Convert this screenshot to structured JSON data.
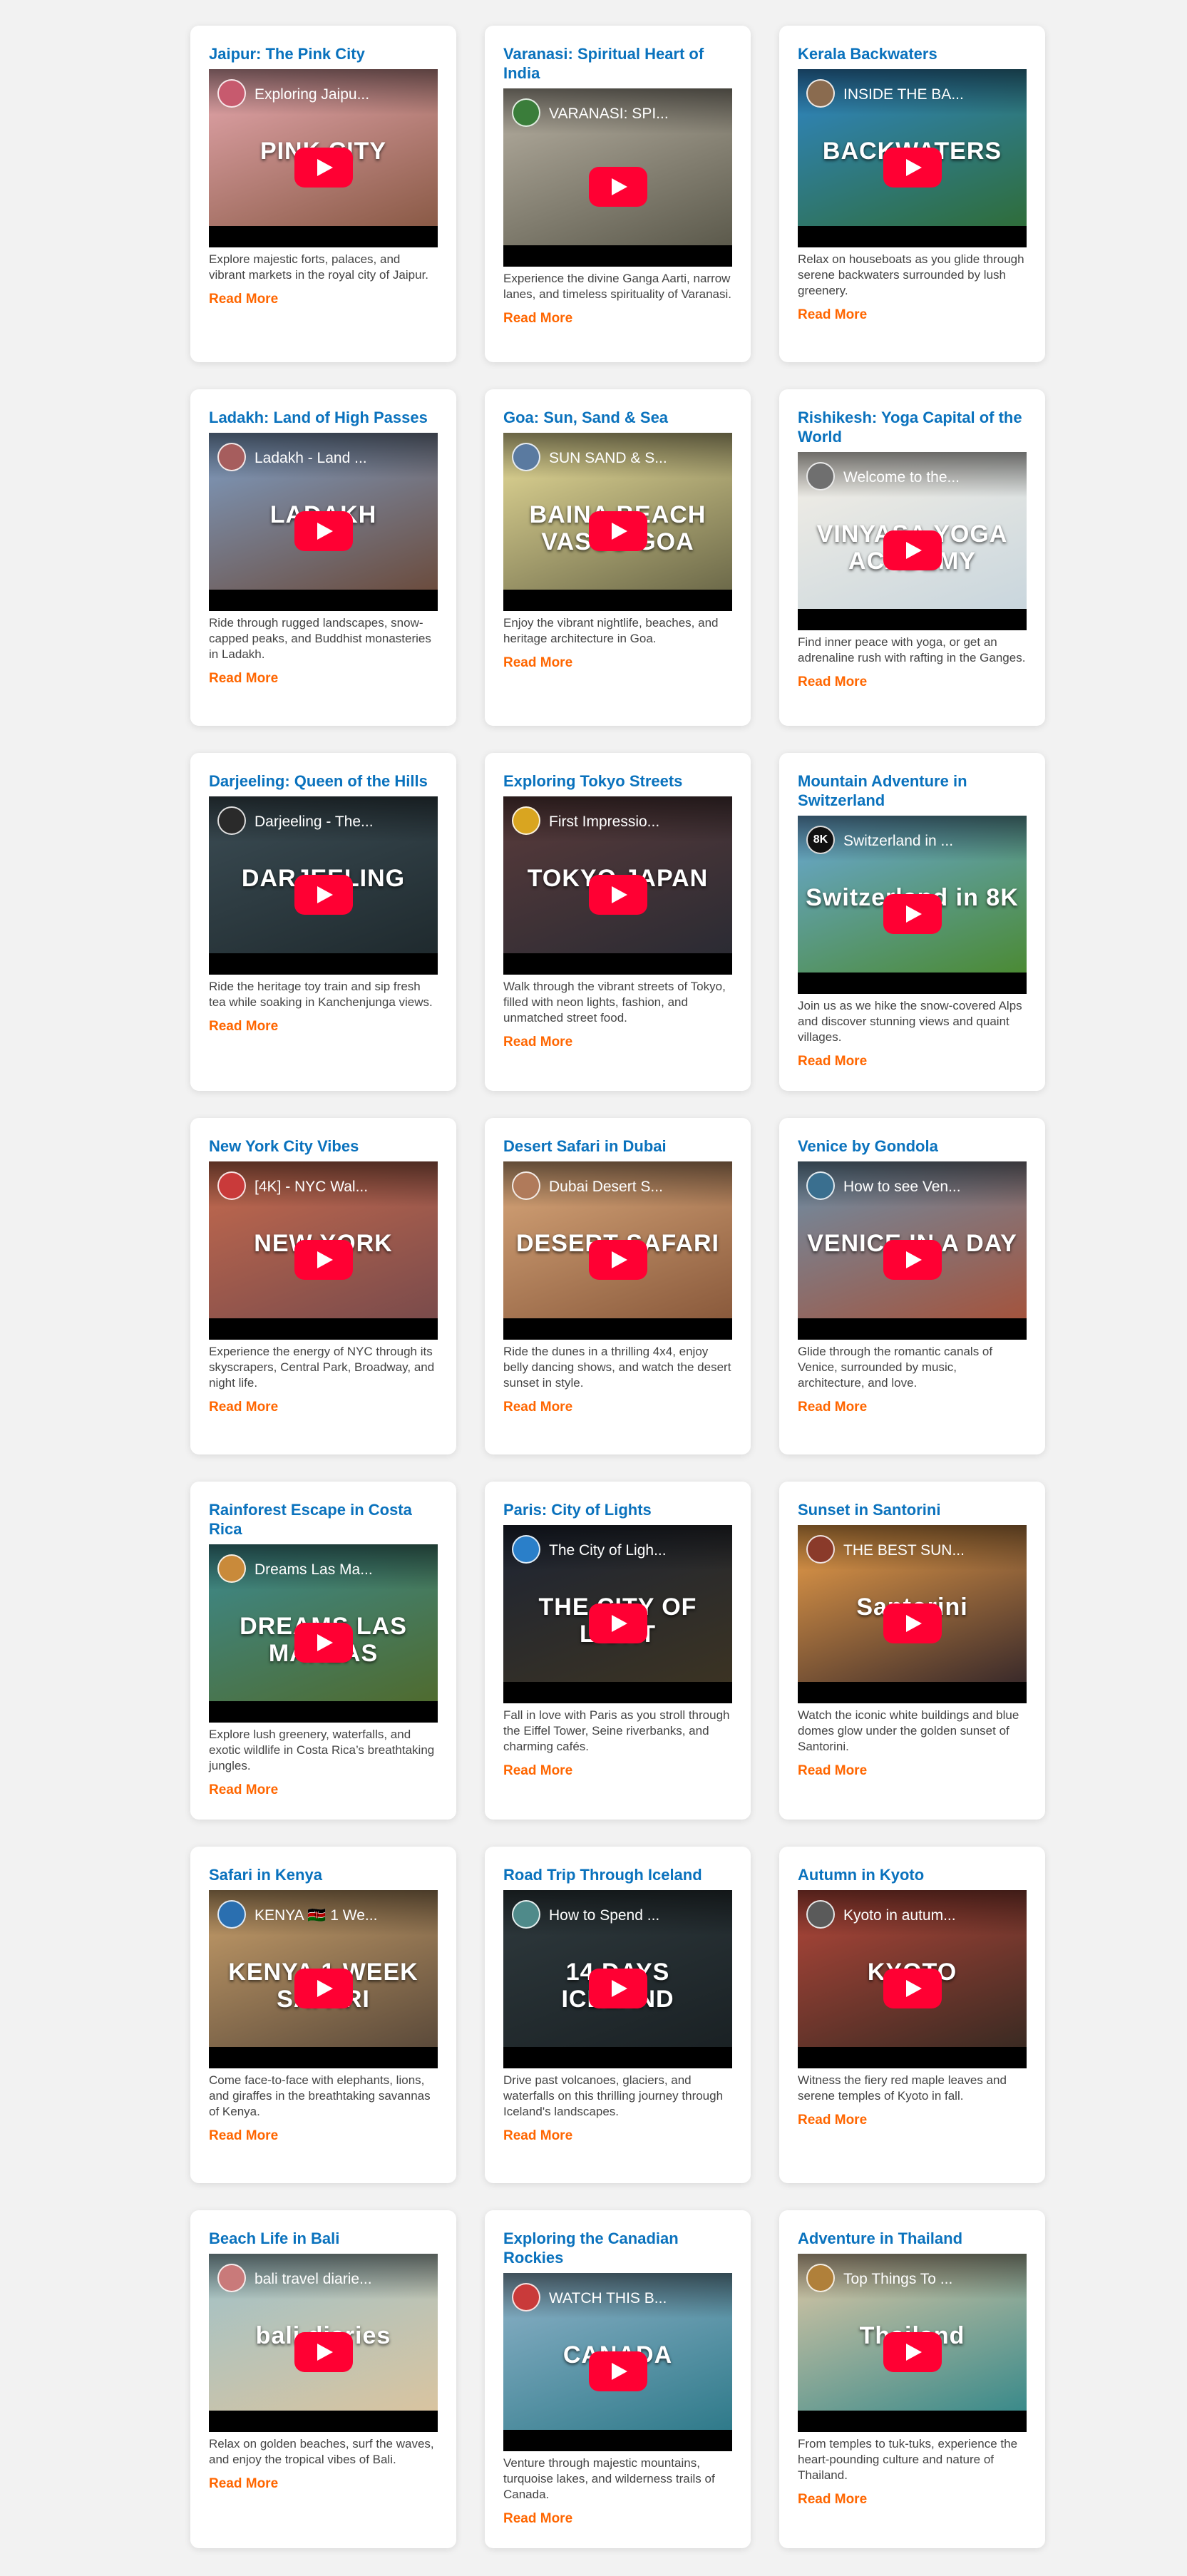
{
  "cards": [
    {
      "title": "Jaipur: The Pink City",
      "video_title": "Exploring Jaipu...",
      "overlay": "PINK CITY",
      "description": "Explore majestic forts, palaces, and vibrant markets in the royal city of Jaipur.",
      "read_more": "Read More",
      "colors": [
        "#e7a9b0",
        "#8a5a46"
      ],
      "avatar_color": "#c75a6e"
    },
    {
      "title": "Varanasi: Spiritual Heart of India",
      "video_title": "VARANASI: SPI...",
      "overlay": "",
      "description": "Experience the divine Ganga Aarti, narrow lanes, and timeless spirituality of Varanasi.",
      "read_more": "Read More",
      "colors": [
        "#b9b2a4",
        "#5c5a4c"
      ],
      "avatar_color": "#3a7d3a"
    },
    {
      "title": "Kerala Backwaters",
      "video_title": "INSIDE THE BA...",
      "overlay": "BACKWATERS",
      "description": "Relax on houseboats as you glide through serene backwaters surrounded by lush greenery.",
      "read_more": "Read More",
      "colors": [
        "#2f86c9",
        "#2f6d3a"
      ],
      "avatar_color": "#8a6b4f"
    },
    {
      "title": "Ladakh: Land of High Passes",
      "video_title": "Ladakh - Land ...",
      "overlay": "LADAKH",
      "description": "Ride through rugged landscapes, snow-capped peaks, and Buddhist monasteries in Ladakh.",
      "read_more": "Read More",
      "colors": [
        "#7f9fc6",
        "#6b4c3e"
      ],
      "avatar_color": "#a65d5d"
    },
    {
      "title": "Goa: Sun, Sand & Sea",
      "video_title": "SUN SAND & S...",
      "overlay": "BAINA BEACH VASCO GOA",
      "description": "Enjoy the vibrant nightlife, beaches, and heritage architecture in Goa.",
      "read_more": "Read More",
      "colors": [
        "#eadf9a",
        "#6d6a4a"
      ],
      "avatar_color": "#5a7aa0"
    },
    {
      "title": "Rishikesh: Yoga Capital of the World",
      "video_title": "Welcome to the...",
      "overlay": "VINYASA YOGA ACADEMY",
      "description": "Find inner peace with yoga, or get an adrenaline rush with rafting in the Ganges.",
      "read_more": "Read More",
      "colors": [
        "#f4efe6",
        "#c9d6dd"
      ],
      "avatar_color": "#6f6f6f"
    },
    {
      "title": "Darjeeling: Queen of the Hills",
      "video_title": "Darjeeling - The...",
      "overlay": "DARJEELING",
      "description": "Ride the heritage toy train and sip fresh tea while soaking in Kanchenjunga views.",
      "read_more": "Read More",
      "colors": [
        "#3c4d55",
        "#1f2a2e"
      ],
      "avatar_color": "#2a2a2a"
    },
    {
      "title": "Exploring Tokyo Streets",
      "video_title": "First Impressio...",
      "overlay": "TOKYO JAPAN",
      "description": "Walk through the vibrant streets of Tokyo, filled with neon lights, fashion, and unmatched street food.",
      "read_more": "Read More",
      "colors": [
        "#5a3b3b",
        "#2b2b33"
      ],
      "avatar_color": "#d9a520"
    },
    {
      "title": "Mountain Adventure in Switzerland",
      "video_title": "Switzerland in ...",
      "overlay": "Switzerland in 8K",
      "description": "Join us as we hike the snow-covered Alps and discover stunning views and quaint villages.",
      "read_more": "Read More",
      "colors": [
        "#6aa9d8",
        "#4b8a34"
      ],
      "avatar_color": "#111111",
      "avatar_text": "8K"
    },
    {
      "title": "New York City Vibes",
      "video_title": "[4K] - NYC Wal...",
      "overlay": "NEW YORK",
      "description": "Experience the energy of NYC through its skyscrapers, Central Park, Broadway, and night life.",
      "read_more": "Read More",
      "colors": [
        "#c56a4e",
        "#7a4b4b"
      ],
      "avatar_color": "#c93a3a"
    },
    {
      "title": "Desert Safari in Dubai",
      "video_title": "Dubai Desert S...",
      "overlay": "DESERT SAFARI",
      "description": "Ride the dunes in a thrilling 4x4, enjoy belly dancing shows, and watch the desert sunset in style.",
      "read_more": "Read More",
      "colors": [
        "#d9a87b",
        "#8a5a3c"
      ],
      "avatar_color": "#b07a5a"
    },
    {
      "title": "Venice by Gondola",
      "video_title": "How to see Ven...",
      "overlay": "VENICE IN A DAY",
      "description": "Glide through the romantic canals of Venice, surrounded by music, architecture, and love.",
      "read_more": "Read More",
      "colors": [
        "#6c8fa8",
        "#a3543e"
      ],
      "avatar_color": "#3a6f8f"
    },
    {
      "title": "Rainforest Escape in Costa Rica",
      "video_title": "Dreams Las Ma...",
      "overlay": "DREAMS LAS MAREAS",
      "description": "Explore lush greenery, waterfalls, and exotic wildlife in Costa Rica’s breathtaking jungles.",
      "read_more": "Read More",
      "colors": [
        "#3c8a8f",
        "#4f6b2f"
      ],
      "avatar_color": "#c98a3a"
    },
    {
      "title": "Paris: City of Lights",
      "video_title": "The City of Ligh...",
      "overlay": "THE CITY OF LIGHT",
      "description": "Fall in love with Paris as you stroll through the Eiffel Tower, Seine riverbanks, and charming cafés.",
      "read_more": "Read More",
      "colors": [
        "#1d2433",
        "#3b3323"
      ],
      "avatar_color": "#2a7fc9"
    },
    {
      "title": "Sunset in Santorini",
      "video_title": "THE BEST SUN...",
      "overlay": "Santorini",
      "description": "Watch the iconic white buildings and blue domes glow under the golden sunset of Santorini.",
      "read_more": "Read More",
      "colors": [
        "#f0a24a",
        "#3a2a2a"
      ],
      "avatar_color": "#8a3a2a"
    },
    {
      "title": "Safari in Kenya",
      "video_title": "KENYA 🇰🇪 1 We...",
      "overlay": "KENYA 1 WEEK SAFARI",
      "description": "Come face-to-face with elephants, lions, and giraffes in the breathtaking savannas of Kenya.",
      "read_more": "Read More",
      "colors": [
        "#c9a06b",
        "#5b4a3a"
      ],
      "avatar_color": "#2a6fb0"
    },
    {
      "title": "Road Trip Through Iceland",
      "video_title": "How to Spend ...",
      "overlay": "14 DAYS ICELAND",
      "description": "Drive past volcanoes, glaciers, and waterfalls on this thrilling journey through Iceland's landscapes.",
      "read_more": "Read More",
      "colors": [
        "#2f3a3e",
        "#1a2124"
      ],
      "avatar_color": "#4f8a8a"
    },
    {
      "title": "Autumn in Kyoto",
      "video_title": "Kyoto in autum...",
      "overlay": "KYOTO",
      "description": "Witness the fiery red maple leaves and serene temples of Kyoto in fall.",
      "read_more": "Read More",
      "colors": [
        "#b5473a",
        "#3a2a22"
      ],
      "avatar_color": "#5a5a5a"
    },
    {
      "title": "Beach Life in Bali",
      "video_title": "bali travel diarie...",
      "overlay": "bali diaries",
      "description": "Relax on golden beaches, surf the waves, and enjoy the tropical vibes of Bali.",
      "read_more": "Read More",
      "colors": [
        "#9fc2c9",
        "#d9c4a0"
      ],
      "avatar_color": "#c97a7a"
    },
    {
      "title": "Exploring the Canadian Rockies",
      "video_title": "WATCH THIS B...",
      "overlay": "CANADA",
      "description": "Venture through majestic mountains, turquoise lakes, and wilderness trails of Canada.",
      "read_more": "Read More",
      "colors": [
        "#8fb3c9",
        "#2f7a8a"
      ],
      "avatar_color": "#c93a3a"
    },
    {
      "title": "Adventure in Thailand",
      "video_title": "Top Things To ...",
      "overlay": "Thailand",
      "description": "From temples to tuk-tuks, experience the heart-pounding culture and nature of Thailand.",
      "read_more": "Read More",
      "colors": [
        "#e0c9a6",
        "#3a8a8a"
      ],
      "avatar_color": "#b0803a"
    }
  ]
}
